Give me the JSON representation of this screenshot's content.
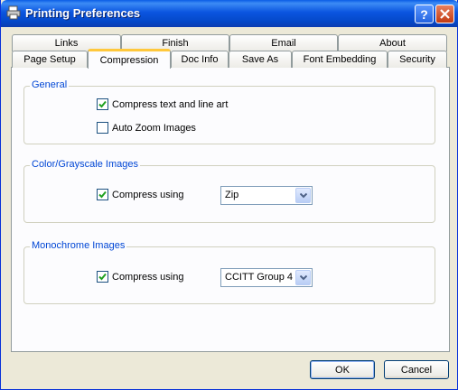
{
  "window": {
    "title": "Printing Preferences"
  },
  "tabs_back": [
    "Links",
    "Finish",
    "Email",
    "About"
  ],
  "tabs_front": [
    "Page Setup",
    "Compression",
    "Doc Info",
    "Save As",
    "Font Embedding",
    "Security"
  ],
  "active_tab": "Compression",
  "general": {
    "label": "General",
    "compress_text": {
      "label": "Compress text and line art",
      "checked": true
    },
    "auto_zoom": {
      "label": "Auto Zoom Images",
      "checked": false
    }
  },
  "color": {
    "label": "Color/Grayscale Images",
    "compress_using": {
      "label": "Compress using",
      "checked": true
    },
    "method": "Zip"
  },
  "mono": {
    "label": "Monochrome Images",
    "compress_using": {
      "label": "Compress using",
      "checked": true
    },
    "method": "CCITT Group 4"
  },
  "buttons": {
    "ok": "OK",
    "cancel": "Cancel"
  },
  "colors": {
    "titlebar": "#0a5ce6",
    "group_label": "#0046d5",
    "dialog_bg": "#ece9d8",
    "active_tab_accent": "#ffc83c"
  }
}
